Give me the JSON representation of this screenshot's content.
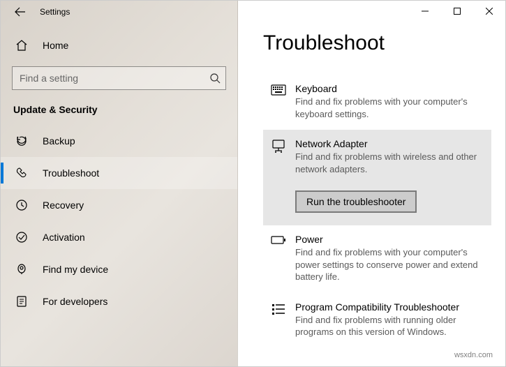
{
  "app_title": "Settings",
  "sidebar": {
    "home_label": "Home",
    "search_placeholder": "Find a setting",
    "section_header": "Update & Security",
    "items": [
      {
        "label": "Backup"
      },
      {
        "label": "Troubleshoot"
      },
      {
        "label": "Recovery"
      },
      {
        "label": "Activation"
      },
      {
        "label": "Find my device"
      },
      {
        "label": "For developers"
      }
    ]
  },
  "main": {
    "page_title": "Troubleshoot",
    "items": [
      {
        "title": "Keyboard",
        "desc": "Find and fix problems with your computer's keyboard settings."
      },
      {
        "title": "Network Adapter",
        "desc": "Find and fix problems with wireless and other network adapters.",
        "run_label": "Run the troubleshooter"
      },
      {
        "title": "Power",
        "desc": "Find and fix problems with your computer's power settings to conserve power and extend battery life."
      },
      {
        "title": "Program Compatibility Troubleshooter",
        "desc": "Find and fix problems with running older programs on this version of Windows."
      }
    ]
  },
  "watermark": "wsxdn.com"
}
